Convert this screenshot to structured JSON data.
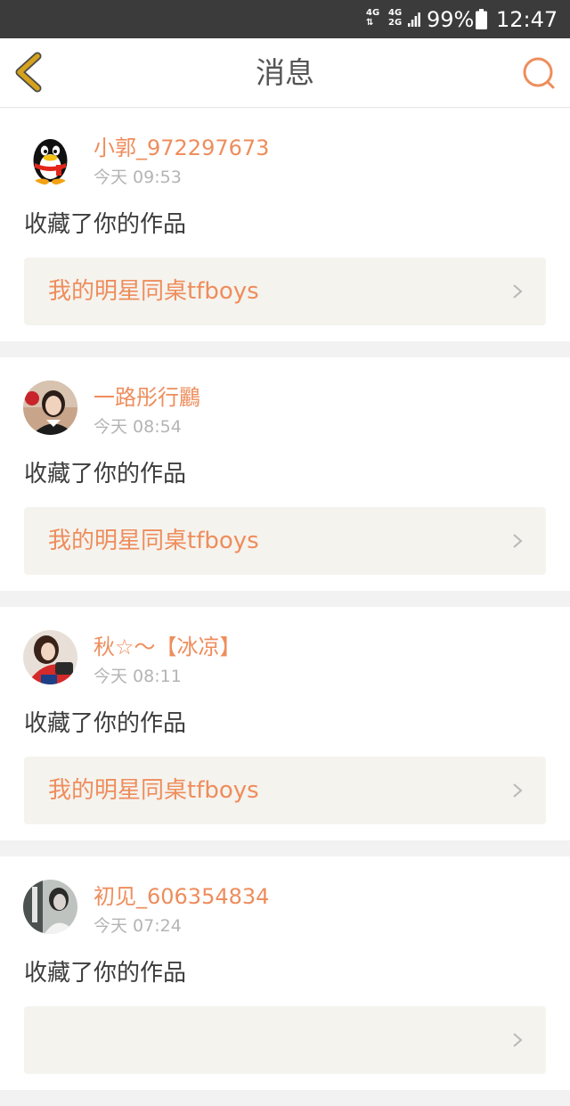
{
  "status_bar": {
    "network_1": [
      "4G",
      "⇅"
    ],
    "network_2": [
      "4G",
      "2G"
    ],
    "battery_percent": "99%",
    "time": "12:47"
  },
  "header": {
    "title": "消息",
    "back_icon": "chevron-left-icon",
    "search_icon": "search-icon"
  },
  "colors": {
    "accent": "#ee8d5c",
    "back_icon": "#d4a21c",
    "card_link_bg": "#f5f3ee",
    "page_bg": "#f2f2f2"
  },
  "messages": [
    {
      "username": "小郭_972297673",
      "time": "今天 09:53",
      "action": "收藏了你的作品",
      "work_title": "我的明星同桌tfboys",
      "avatar": "penguin-avatar"
    },
    {
      "username": "一路彤行鸝",
      "time": "今天 08:54",
      "action": "收藏了你的作品",
      "work_title": "我的明星同桌tfboys",
      "avatar": "user-photo-avatar"
    },
    {
      "username": "秋☆～【冰凉】",
      "time": "今天 08:11",
      "action": "收藏了你的作品",
      "work_title": "我的明星同桌tfboys",
      "avatar": "user-photo-avatar"
    },
    {
      "username": "初见_606354834",
      "time": "今天 07:24",
      "action": "收藏了你的作品",
      "work_title": "",
      "avatar": "user-photo-avatar"
    }
  ]
}
